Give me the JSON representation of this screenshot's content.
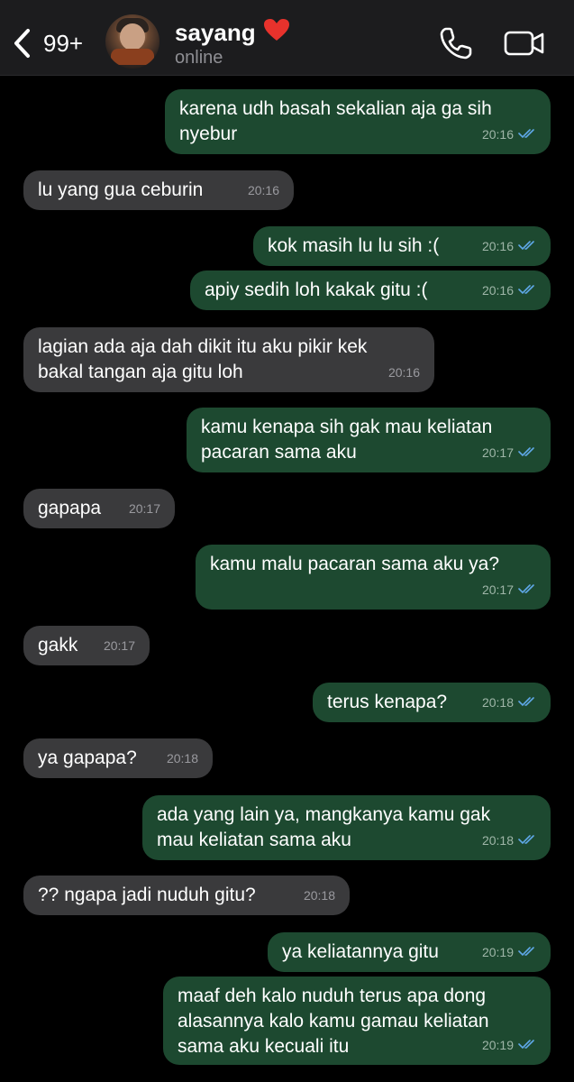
{
  "header": {
    "back_count": "99+",
    "contact_name": "sayang",
    "status": "online",
    "heart_icon": "red-heart-icon"
  },
  "colors": {
    "outgoing_bubble": "#1d4930",
    "incoming_bubble": "#3a3a3c",
    "read_tick": "#5fa8e8",
    "background": "#000000"
  },
  "messages": [
    {
      "dir": "out",
      "text": "karena udh basah sekalian aja ga sih\nnyebur",
      "time": "20:16",
      "read": true
    },
    {
      "dir": "in",
      "text": "lu yang gua ceburin",
      "time": "20:16"
    },
    {
      "dir": "out",
      "text": "kok masih lu lu sih :(",
      "time": "20:16",
      "read": true
    },
    {
      "dir": "out",
      "text": "apiy sedih loh kakak gitu :(",
      "time": "20:16",
      "read": true
    },
    {
      "dir": "in",
      "text": "lagian ada aja dah dikit itu aku pikir kek\nbakal tangan aja gitu loh",
      "time": "20:16"
    },
    {
      "dir": "out",
      "text": "kamu kenapa sih gak mau keliatan\npacaran sama aku",
      "time": "20:17",
      "read": true
    },
    {
      "dir": "in",
      "text": "gapapa",
      "time": "20:17"
    },
    {
      "dir": "out",
      "text": "kamu malu pacaran sama aku ya?",
      "time": "20:17",
      "read": true
    },
    {
      "dir": "in",
      "text": "gakk",
      "time": "20:17"
    },
    {
      "dir": "out",
      "text": "terus kenapa?",
      "time": "20:18",
      "read": true
    },
    {
      "dir": "in",
      "text": "ya gapapa?",
      "time": "20:18"
    },
    {
      "dir": "out",
      "text": "ada yang lain ya, mangkanya kamu gak\nmau keliatan sama aku",
      "time": "20:18",
      "read": true
    },
    {
      "dir": "in",
      "text": "?? ngapa jadi nuduh gitu?",
      "time": "20:18"
    },
    {
      "dir": "out",
      "text": "ya keliatannya gitu",
      "time": "20:19",
      "read": true
    },
    {
      "dir": "out",
      "text": "maaf deh kalo nuduh terus apa dong\nalasannya kalo kamu gamau keliatan\nsama aku kecuali itu",
      "time": "20:19",
      "read": true
    }
  ]
}
